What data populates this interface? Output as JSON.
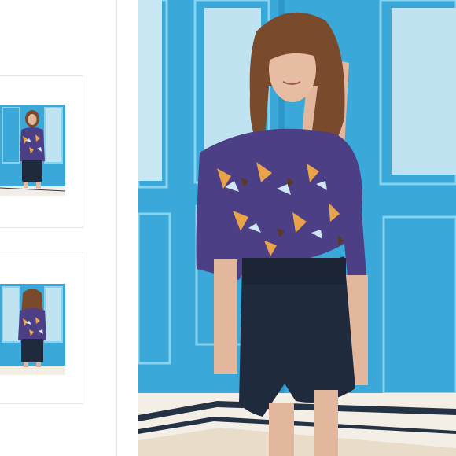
{
  "gallery": {
    "thumbnails": [
      {
        "icon": "product-photo-front",
        "selected": true
      },
      {
        "icon": "product-photo-back",
        "selected": false
      }
    ],
    "main_image": {
      "icon": "product-photo-front-large"
    }
  },
  "colors": {
    "wall_blue": "#3aa9d9",
    "panel_light": "#bfe3f1",
    "molding": "#7fd0ee",
    "shorts_navy": "#1f2a3d",
    "blouse_purple": "#4c3f86",
    "hair_brown": "#7a4a2c",
    "skin": "#e2b79d"
  }
}
